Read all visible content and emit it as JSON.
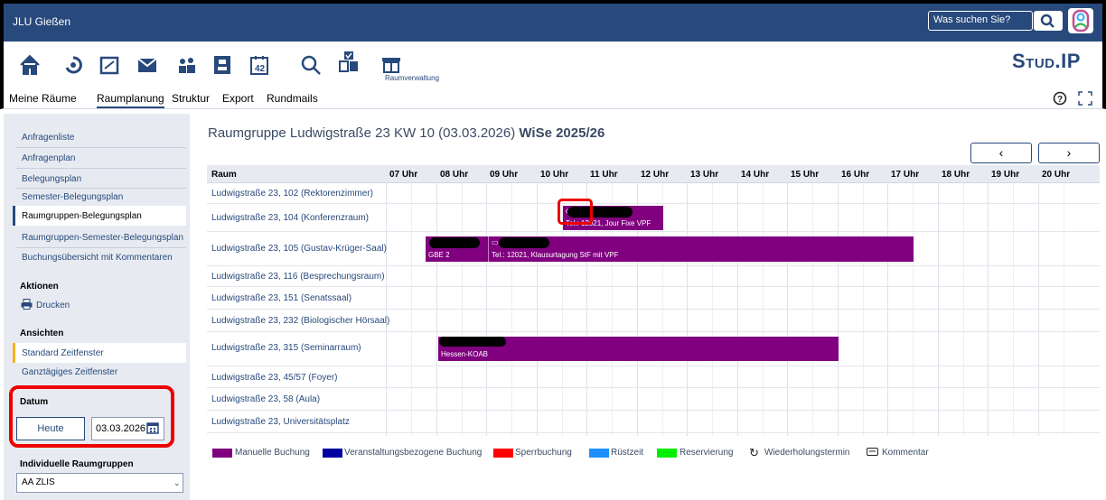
{
  "topbar": {
    "brand": "JLU Gießen",
    "search_placeholder": "Was suchen Sie?"
  },
  "iconbar": {
    "raumverwaltung_caption": "Raumverwaltung",
    "logo": "Stud.IP"
  },
  "tabs": [
    {
      "label": "Meine Räume"
    },
    {
      "label": "Raumplanung"
    },
    {
      "label": "Struktur"
    },
    {
      "label": "Export"
    },
    {
      "label": "Rundmails"
    }
  ],
  "sidebar": {
    "links": [
      "Anfragenliste",
      "Anfragenplan",
      "Belegungsplan",
      "Semester-Belegungsplan",
      "Raumgruppen-Belegungsplan",
      "Raumgruppen-Semester-Belegungsplan",
      "Buchungsübersicht mit Kommentaren"
    ],
    "aktionen_head": "Aktionen",
    "drucken": "Drucken",
    "ansichten_head": "Ansichten",
    "ansichten": [
      "Standard Zeitfenster",
      "Ganztägiges Zeitfenster"
    ],
    "datum_head": "Datum",
    "heute_label": "Heute",
    "date_value": "03.03.2026",
    "raumgruppen_head": "Individuelle Raumgruppen",
    "raumgruppen_value": "AA ZLIS"
  },
  "main": {
    "title_main": "Raumgruppe Ludwigstraße 23 KW 10 (03.03.2026) ",
    "title_semester": "WiSe 2025/26",
    "prev": "‹",
    "next": "›",
    "room_header": "Raum",
    "hours": [
      "07 Uhr",
      "08 Uhr",
      "09 Uhr",
      "10 Uhr",
      "11 Uhr",
      "12 Uhr",
      "13 Uhr",
      "14 Uhr",
      "15 Uhr",
      "16 Uhr",
      "17 Uhr",
      "18 Uhr",
      "19 Uhr",
      "20 Uhr"
    ],
    "rooms": [
      "Ludwigstraße 23, 102 (Rektorenzimmer)",
      "Ludwigstraße 23, 104 (Konferenzraum)",
      "Ludwigstraße 23, 105 (Gustav-Krüger-Saal)",
      "Ludwigstraße 23, 116 (Besprechungsraum)",
      "Ludwigstraße 23, 151 (Senatssaal)",
      "Ludwigstraße 23, 232 (Biologischer Hörsaal)",
      "Ludwigstraße 23, 315 (Seminarraum)",
      "Ludwigstraße 23, 45/57 (Foyer)",
      "Ludwigstraße 23, 58 (Aula)",
      "Ludwigstraße 23, Universitätsplatz"
    ],
    "bookings": [
      {
        "label": "Tel.: 12021, Jour Fixe VPF",
        "color": "#800080"
      },
      {
        "label": "GBE 2",
        "color": "#800080"
      },
      {
        "label": "Tel.: 12021, Klausurtagung StF mit VPF",
        "color": "#800080"
      },
      {
        "label": "Hessen-KOAB",
        "color": "#800080"
      }
    ]
  },
  "legend": [
    {
      "label": "Manuelle Buchung",
      "color": "#800080"
    },
    {
      "label": "Veranstaltungsbezogene Buchung",
      "color": "#0000a0"
    },
    {
      "label": "Sperrbuchung",
      "color": "#ff0000"
    },
    {
      "label": "Rüstzeit",
      "color": "#1e90ff"
    },
    {
      "label": "Reservierung",
      "color": "#00ee00"
    },
    {
      "label": "Wiederholungstermin",
      "color": "#000000"
    },
    {
      "label": "Kommentar",
      "color": "#000000"
    }
  ]
}
